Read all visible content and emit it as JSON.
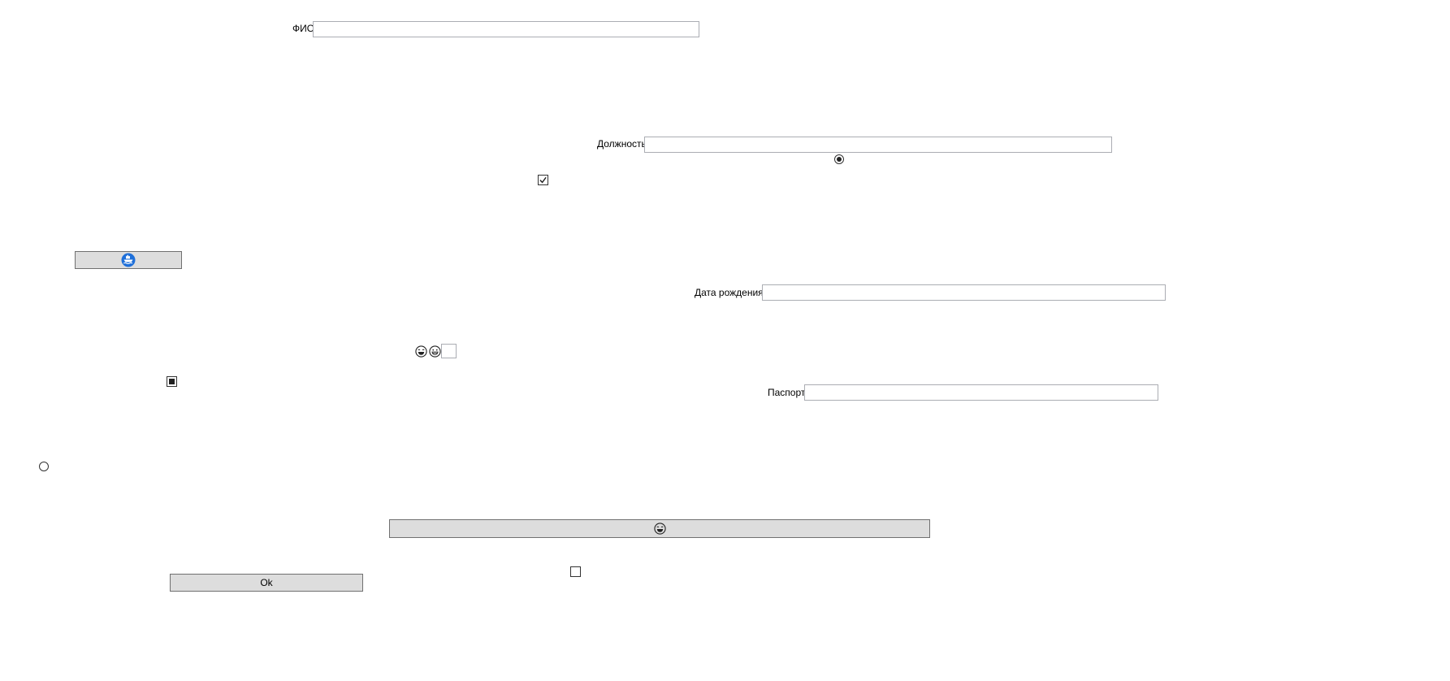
{
  "form": {
    "fio_label": "ФИО",
    "fio_value": "",
    "position_label": "Должность",
    "position_value": "",
    "birthdate_label": "Дата рождения",
    "birthdate_value": "",
    "passport_label": "Паспорт",
    "passport_value": "",
    "small_input_value": ""
  },
  "controls": {
    "radio_1_checked": true,
    "radio_2_checked": false,
    "checkbox_1_state": "checked",
    "checkbox_2_state": "indeterminate",
    "checkbox_3_state": "unchecked"
  },
  "buttons": {
    "ok_label": "Ok",
    "icon_button_1_icon": "ship-badge-icon",
    "icon_button_2_icon": "emoji-laughing-icon"
  },
  "icons": {
    "emoji_1": "laughing-face-icon",
    "emoji_2": "grinning-face-icon"
  },
  "colors": {
    "button_bg": "#dddddd",
    "button_border": "#707070",
    "input_border": "#abadb3",
    "accent_blue": "#1e6fd9"
  }
}
